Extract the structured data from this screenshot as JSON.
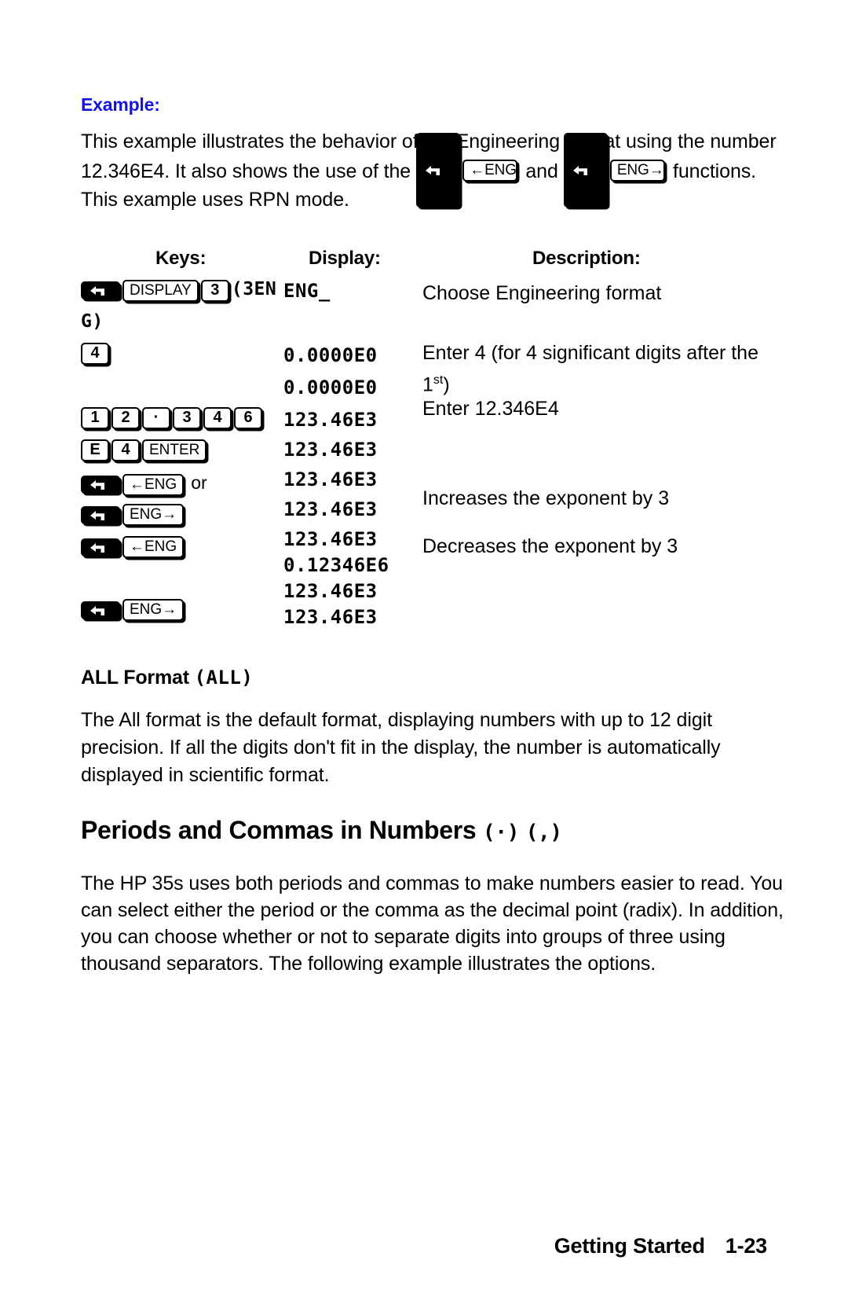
{
  "example": {
    "label": "Example:",
    "intro_line1": "This example illustrates the behavior of the Engineering format using the number",
    "intro_line2_a": "12.346E4. It also shows the use of the ",
    "intro_line2_b": " and ",
    "intro_line2_c": " functions.",
    "intro_line3": "This example uses RPN mode.",
    "key_shift": "shift-left-arrow",
    "key_eng_left": "←ENG",
    "key_eng_right": "ENG→"
  },
  "table": {
    "headers": {
      "keys": "Keys:",
      "display": "Display:",
      "description": "Description:"
    },
    "keys_rows": [
      {
        "keys": [
          "shift",
          "DISPLAY",
          "3"
        ],
        "trailing": "(3EN"
      },
      {
        "keys": [],
        "trailing": "G)"
      },
      {
        "keys": [
          "4"
        ],
        "trailing": ""
      },
      {
        "keys": [
          "1",
          "2",
          "·",
          "3",
          "4",
          "6"
        ],
        "trailing": ""
      },
      {
        "keys": [
          "E",
          "4",
          "ENTER"
        ],
        "trailing": ""
      },
      {
        "keys": [
          "shift",
          "←ENG"
        ],
        "trailing": "or"
      },
      {
        "keys": [
          "shift",
          "ENG→"
        ],
        "trailing": ""
      },
      {
        "keys": [
          "shift",
          "←ENG"
        ],
        "trailing": ""
      },
      {
        "keys": [],
        "trailing": ""
      },
      {
        "keys": [
          "shift",
          "ENG→"
        ],
        "trailing": ""
      }
    ],
    "display_rows": [
      "ENG_",
      "",
      "0.0000E0",
      "0.0000E0",
      "123.46E3",
      "123.46E3",
      "123.46E3",
      "123.46E3",
      "123.46E3",
      "0.12346E6",
      "123.46E3",
      "123.46E3"
    ],
    "description_rows": [
      "Choose Engineering format",
      "",
      "Enter 4 (for 4 significant digits after the",
      "1st)",
      "Enter 12.346E4",
      "",
      "",
      "Increases the exponent by 3",
      "Decreases the exponent by 3"
    ],
    "desc_sup_base": "1",
    "desc_sup_text": "st",
    "desc_sup_tail": ")"
  },
  "all_format": {
    "heading_bold": "ALL Format ",
    "heading_lcd": "(ALL)",
    "lines": [
      "The All format is the default format, displaying numbers with up to 12 digit",
      "precision. If all the digits don't fit in the display, the number is automatically",
      "displayed in scientific format."
    ]
  },
  "periods_section": {
    "heading_text": "Periods and Commas in Numbers ",
    "heading_sym_period": "(·)",
    "heading_sym_comma": "(,)",
    "lines": [
      "The HP 35s uses both periods and commas to make numbers easier to read.  You",
      "can select either the period or the comma as the decimal point (radix). In addition,",
      "you can choose whether or not to separate digits into groups of three using",
      "thousand separators. The following example illustrates the options."
    ]
  },
  "footer": {
    "chapter": "Getting Started",
    "page": "1-23"
  },
  "colors": {
    "example_blue": "#1414dc",
    "text_black": "#000000",
    "background": "#ffffff"
  }
}
